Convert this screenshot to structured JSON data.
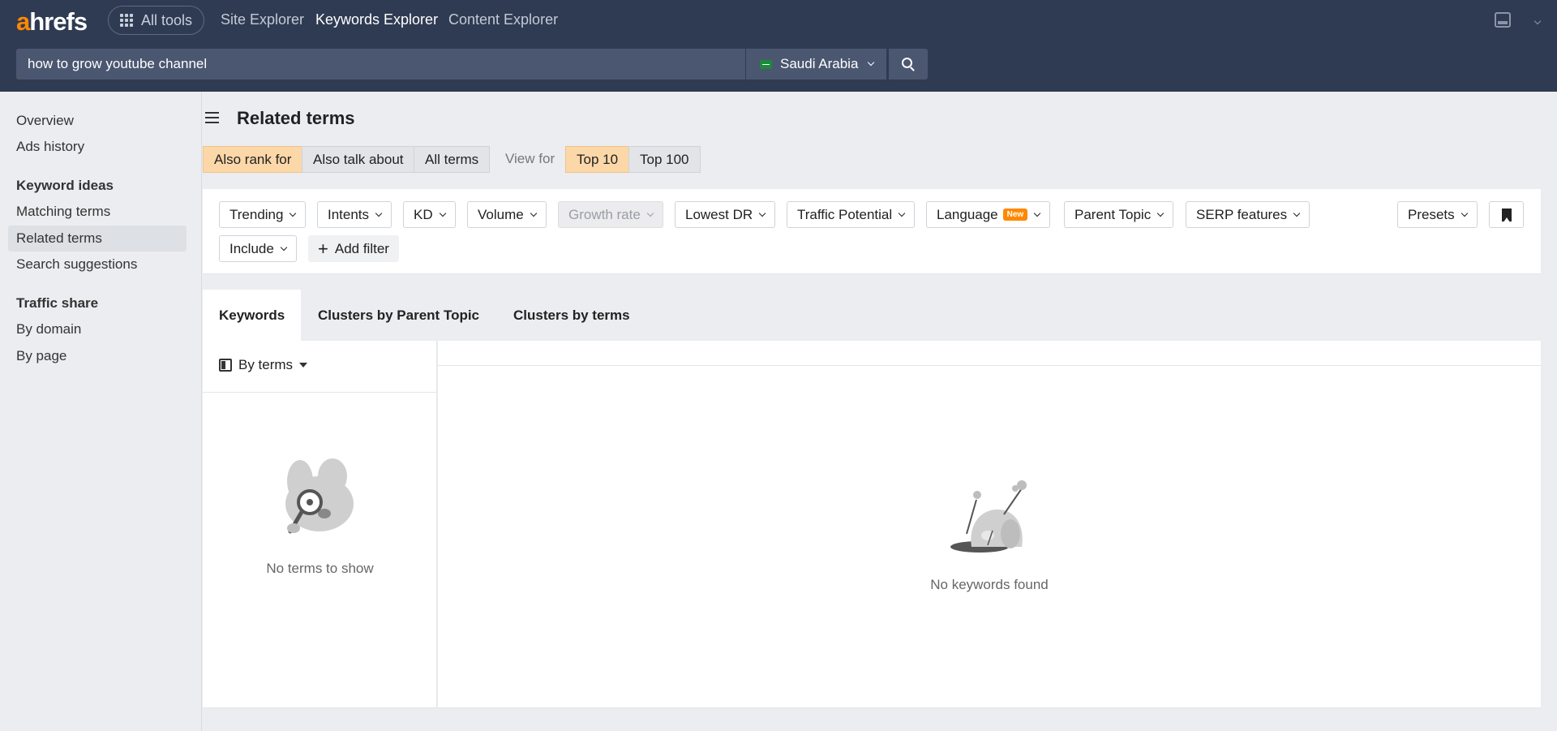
{
  "header": {
    "logo_a": "a",
    "logo_rest": "hrefs",
    "all_tools": "All tools",
    "nav": [
      "Site Explorer",
      "Keywords Explorer",
      "Content Explorer"
    ],
    "active_nav": "Keywords Explorer",
    "search_query": "how to grow youtube channel",
    "country": "Saudi Arabia"
  },
  "sidebar": {
    "items_top": [
      "Overview",
      "Ads history"
    ],
    "section_keyword_ideas": "Keyword ideas",
    "keyword_ideas": [
      "Matching terms",
      "Related terms",
      "Search suggestions"
    ],
    "active_item": "Related terms",
    "section_traffic_share": "Traffic share",
    "traffic_share": [
      "By domain",
      "By page"
    ]
  },
  "main": {
    "title": "Related terms",
    "modes": [
      "Also rank for",
      "Also talk about",
      "All terms"
    ],
    "active_mode": "Also rank for",
    "view_for_label": "View for",
    "view_for": [
      "Top 10",
      "Top 100"
    ],
    "active_view_for": "Top 10",
    "filters": [
      "Trending",
      "Intents",
      "KD",
      "Volume",
      "Growth rate",
      "Lowest DR",
      "Traffic Potential",
      "Language",
      "Parent Topic",
      "SERP features"
    ],
    "language_badge": "New",
    "presets": "Presets",
    "include": "Include",
    "add_filter": "Add filter",
    "tabs": [
      "Keywords",
      "Clusters by Parent Topic",
      "Clusters by terms"
    ],
    "active_tab": "Keywords",
    "by_terms": "By terms",
    "empty_terms": "No terms to show",
    "empty_keywords": "No keywords found"
  },
  "colors": {
    "topbar": "#2f3b52",
    "accent": "#ff8800",
    "selected_segment": "#fcd7a8"
  }
}
